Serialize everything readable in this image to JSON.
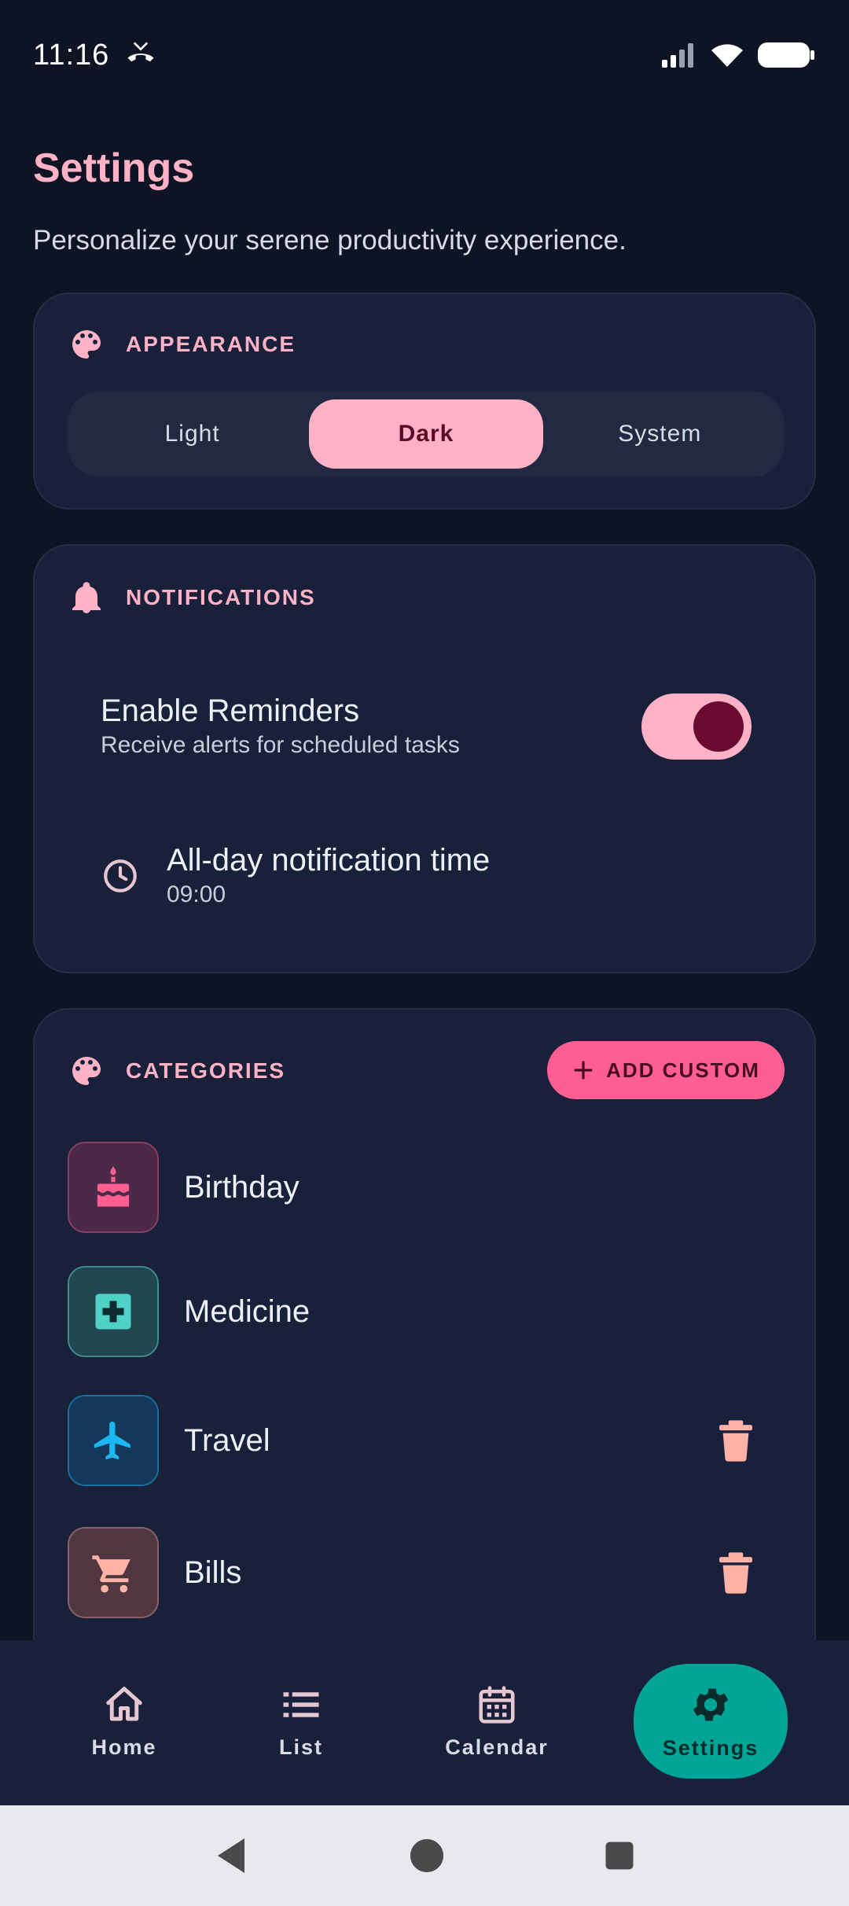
{
  "status": {
    "time": "11:16"
  },
  "page": {
    "title": "Settings",
    "subtitle": "Personalize your serene productivity experience."
  },
  "appearance": {
    "label": "APPEARANCE",
    "options": [
      "Light",
      "Dark",
      "System"
    ],
    "selected": "Dark"
  },
  "notifications": {
    "label": "NOTIFICATIONS",
    "reminders_title": "Enable Reminders",
    "reminders_sub": "Receive alerts for scheduled tasks",
    "reminders_enabled": true,
    "allday_title": "All-day notification time",
    "allday_time": "09:00"
  },
  "categories": {
    "label": "CATEGORIES",
    "add_label": "ADD CUSTOM",
    "items": [
      {
        "name": "Birthday",
        "icon": "cake-icon",
        "color": "#ff5e93",
        "deletable": false
      },
      {
        "name": "Medicine",
        "icon": "medical-cross-icon",
        "color": "#4fd1c5",
        "deletable": false
      },
      {
        "name": "Travel",
        "icon": "airplane-icon",
        "color": "#1ab7f0",
        "deletable": true
      },
      {
        "name": "Bills",
        "icon": "cart-icon",
        "color": "#ffb3a7",
        "deletable": true
      }
    ]
  },
  "nav": {
    "items": [
      {
        "label": "Home",
        "icon": "home-icon"
      },
      {
        "label": "List",
        "icon": "list-icon"
      },
      {
        "label": "Calendar",
        "icon": "calendar-icon"
      },
      {
        "label": "Settings",
        "icon": "gear-icon"
      }
    ],
    "active": "Settings"
  },
  "colors": {
    "accent": "#ffb1c6",
    "background": "#0e1424",
    "card": "#19203a",
    "active_nav": "#00a597",
    "add_button": "#ff5e93"
  }
}
